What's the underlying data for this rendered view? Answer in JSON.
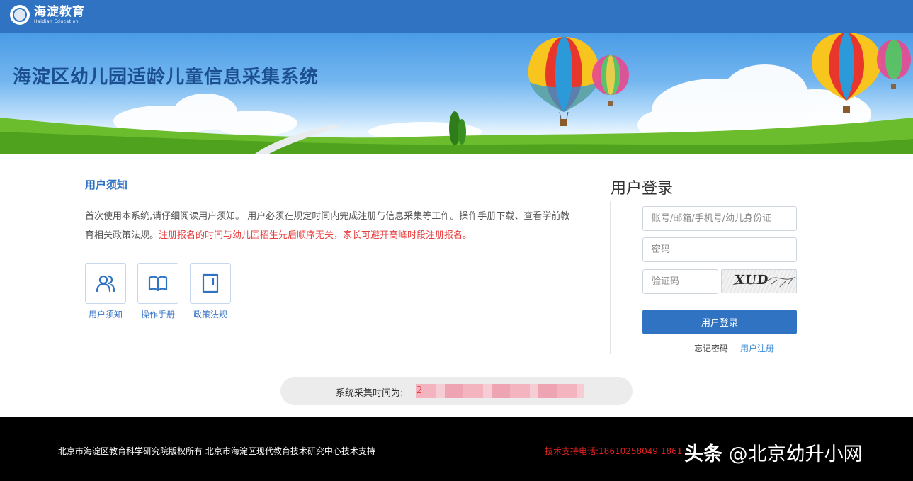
{
  "header": {
    "logo_cn": "海淀教育",
    "logo_en": "Haidian Education"
  },
  "banner": {
    "title": "海淀区幼儿园适龄儿童信息采集系统"
  },
  "notice": {
    "title": "用户须知",
    "text_normal": "首次使用本系统,请仔细阅读用户须知。 用户必须在规定时间内完成注册与信息采集等工作。操作手册下载、查看学前教育相关政策法规。",
    "text_red": "注册报名的时间与幼儿园招生先后顺序无关，家长可避开高峰时段注册报名。"
  },
  "quick_links": [
    {
      "label": "用户须知",
      "icon": "users-icon"
    },
    {
      "label": "操作手册",
      "icon": "book-icon"
    },
    {
      "label": "政策法规",
      "icon": "document-icon"
    }
  ],
  "login": {
    "title": "用户登录",
    "account_placeholder": "账号/邮箱/手机号/幼儿身份证",
    "password_placeholder": "密码",
    "captcha_placeholder": "验证码",
    "captcha_text": "XUD",
    "submit_label": "用户登录",
    "forgot_label": "忘记密码",
    "register_label": "用户注册"
  },
  "collection": {
    "label": "系统采集时间为:",
    "value": "2"
  },
  "footer": {
    "copyright": "北京市海淀区教育科学研究院版权所有 北京市海淀区现代教育技术研究中心技术支持",
    "support": "技术支持电话:18610258049 1861"
  },
  "watermark": {
    "brand": "头条",
    "handle": "@北京幼升小网"
  },
  "colors": {
    "brand_blue": "#2f73c2",
    "link_blue": "#3b8ad9",
    "alert_red": "#e83e3e",
    "footer_bg": "#000000"
  }
}
